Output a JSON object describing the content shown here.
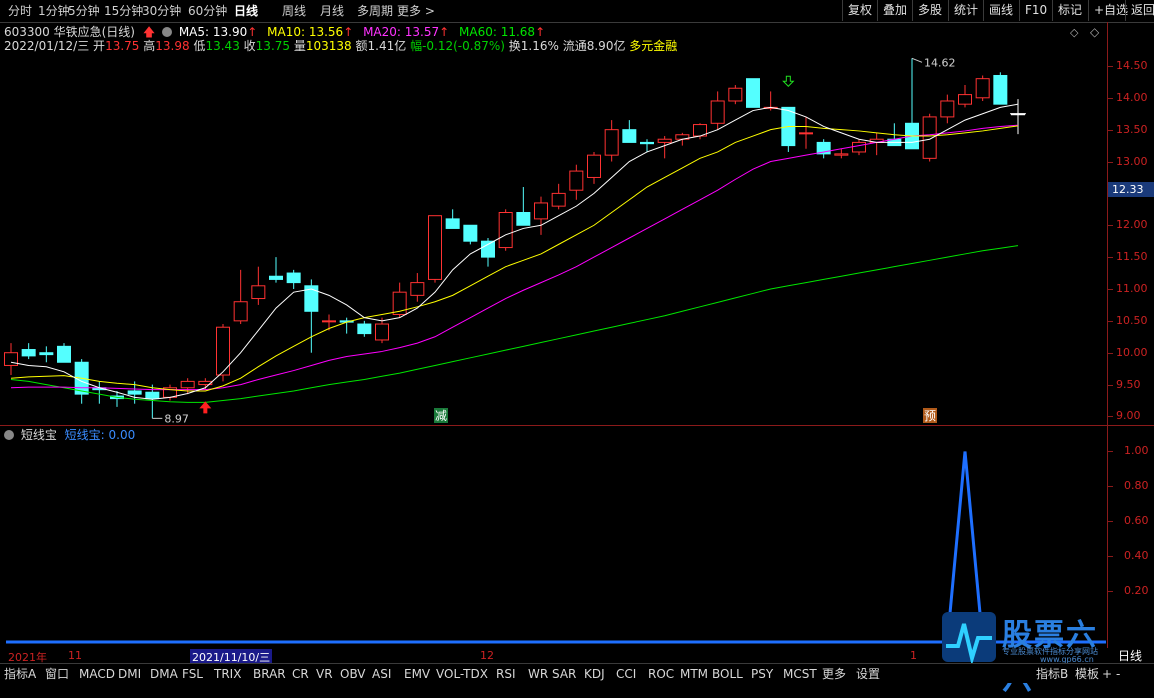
{
  "toolbar": {
    "periods": [
      "分时",
      "1分钟",
      "5分钟",
      "15分钟",
      "30分钟",
      "60分钟",
      "日线",
      "周线",
      "月线",
      "多周期",
      "更多 >"
    ],
    "active_period": "日线",
    "right_buttons": [
      "复权",
      "叠加",
      "多股",
      "统计",
      "画线",
      "F10",
      "标记",
      "+自选",
      "返回"
    ]
  },
  "stock": {
    "header": "603300 华铁应急(日线)",
    "ma5": "MA5: 13.90",
    "ma10": "MA10: 13.56",
    "ma20": "MA20: 13.57",
    "ma60": "MA60: 11.68",
    "date": "2022/01/12/三",
    "open_label": "开",
    "open": "13.75",
    "high_label": "高",
    "high": "13.98",
    "low_label": "低",
    "low": "13.43",
    "close_label": "收",
    "close": "13.75",
    "vol_label": "量",
    "vol": "103138",
    "amt": "额1.41亿",
    "chg": "幅-0.12(-0.87%)",
    "turnover": "换1.16%",
    "float": "流通8.90亿",
    "concept": "多元金融"
  },
  "price_axis": [
    "14.50",
    "14.00",
    "13.50",
    "13.00",
    "12.50",
    "12.00",
    "11.50",
    "11.00",
    "10.50",
    "10.00",
    "9.50",
    "9.00"
  ],
  "current_price_tag": "12.33",
  "annotations": {
    "high_mark": "14.62",
    "low_mark": "8.97",
    "sig_jian": "减",
    "sig_yu": "预"
  },
  "indicator": {
    "name": "短线宝",
    "value_text": "短线宝: 0.00",
    "axis": [
      "1.00",
      "0.80",
      "0.60",
      "0.40",
      "0.20"
    ]
  },
  "date_axis": [
    "2021年",
    "11",
    "2021/11/10/三",
    "12",
    "1"
  ],
  "bottom_tabs": [
    "指标A",
    "窗口",
    "MACD",
    "DMI",
    "DMA",
    "FSL",
    "TRIX",
    "BRAR",
    "CR",
    "VR",
    "OBV",
    "ASI",
    "EMV",
    "VOL-TDX",
    "RSI",
    "WR",
    "SAR",
    "KDJ",
    "CCI",
    "ROC",
    "MTM",
    "BOLL",
    "PSY",
    "MCST",
    "更多",
    "设置"
  ],
  "bottom_right": [
    "指标B",
    "模板",
    "+",
    "-",
    "日线"
  ],
  "watermark": {
    "title": "股票六六",
    "sub": "专业股票软件指标分享网站",
    "url": "www.gp66.cn"
  },
  "colors": {
    "up": "#ff3232",
    "down": "#54ffff",
    "ma5": "#ffffff",
    "ma10": "#ffff00",
    "ma20": "#ff00ff",
    "ma60": "#00e600",
    "indicator": "#1e6fff"
  },
  "chart_data": {
    "type": "candlestick",
    "price_range": [
      8.85,
      14.75
    ],
    "candles": [
      {
        "o": 9.8,
        "h": 10.15,
        "l": 9.65,
        "c": 10.0
      },
      {
        "o": 10.05,
        "h": 10.15,
        "l": 9.9,
        "c": 9.95
      },
      {
        "o": 10.0,
        "h": 10.1,
        "l": 9.85,
        "c": 9.97
      },
      {
        "o": 10.1,
        "h": 10.15,
        "l": 9.85,
        "c": 9.85
      },
      {
        "o": 9.85,
        "h": 9.9,
        "l": 9.2,
        "c": 9.35
      },
      {
        "o": 9.45,
        "h": 9.55,
        "l": 9.2,
        "c": 9.42
      },
      {
        "o": 9.32,
        "h": 9.4,
        "l": 9.15,
        "c": 9.28
      },
      {
        "o": 9.4,
        "h": 9.55,
        "l": 9.2,
        "c": 9.35
      },
      {
        "o": 9.38,
        "h": 9.5,
        "l": 8.97,
        "c": 9.28
      },
      {
        "o": 9.3,
        "h": 9.5,
        "l": 9.25,
        "c": 9.45
      },
      {
        "o": 9.45,
        "h": 9.6,
        "l": 9.35,
        "c": 9.55
      },
      {
        "o": 9.5,
        "h": 9.6,
        "l": 9.42,
        "c": 9.55
      },
      {
        "o": 9.65,
        "h": 10.45,
        "l": 9.55,
        "c": 10.4
      },
      {
        "o": 10.5,
        "h": 11.3,
        "l": 10.45,
        "c": 10.8
      },
      {
        "o": 10.85,
        "h": 11.35,
        "l": 10.75,
        "c": 11.05
      },
      {
        "o": 11.2,
        "h": 11.5,
        "l": 11.1,
        "c": 11.15
      },
      {
        "o": 11.25,
        "h": 11.3,
        "l": 11.0,
        "c": 11.1
      },
      {
        "o": 11.05,
        "h": 11.15,
        "l": 10.0,
        "c": 10.65
      },
      {
        "o": 10.5,
        "h": 10.6,
        "l": 10.35,
        "c": 10.5
      },
      {
        "o": 10.5,
        "h": 10.55,
        "l": 10.3,
        "c": 10.48
      },
      {
        "o": 10.45,
        "h": 10.5,
        "l": 10.25,
        "c": 10.3
      },
      {
        "o": 10.2,
        "h": 10.55,
        "l": 10.15,
        "c": 10.45
      },
      {
        "o": 10.6,
        "h": 11.1,
        "l": 10.55,
        "c": 10.95
      },
      {
        "o": 10.9,
        "h": 11.25,
        "l": 10.8,
        "c": 11.1
      },
      {
        "o": 11.15,
        "h": 12.15,
        "l": 11.1,
        "c": 12.15
      },
      {
        "o": 12.1,
        "h": 12.25,
        "l": 11.95,
        "c": 11.95
      },
      {
        "o": 12.0,
        "h": 12.0,
        "l": 11.7,
        "c": 11.75
      },
      {
        "o": 11.75,
        "h": 11.8,
        "l": 11.35,
        "c": 11.5
      },
      {
        "o": 11.65,
        "h": 12.25,
        "l": 11.6,
        "c": 12.2
      },
      {
        "o": 12.2,
        "h": 12.6,
        "l": 12.0,
        "c": 12.0
      },
      {
        "o": 12.1,
        "h": 12.45,
        "l": 11.85,
        "c": 12.35
      },
      {
        "o": 12.3,
        "h": 12.65,
        "l": 12.25,
        "c": 12.5
      },
      {
        "o": 12.55,
        "h": 12.95,
        "l": 12.4,
        "c": 12.85
      },
      {
        "o": 12.75,
        "h": 13.15,
        "l": 12.65,
        "c": 13.1
      },
      {
        "o": 13.1,
        "h": 13.65,
        "l": 13.0,
        "c": 13.5
      },
      {
        "o": 13.5,
        "h": 13.65,
        "l": 13.3,
        "c": 13.3
      },
      {
        "o": 13.3,
        "h": 13.35,
        "l": 13.15,
        "c": 13.28
      },
      {
        "o": 13.3,
        "h": 13.4,
        "l": 13.05,
        "c": 13.35
      },
      {
        "o": 13.35,
        "h": 13.45,
        "l": 13.25,
        "c": 13.42
      },
      {
        "o": 13.4,
        "h": 13.6,
        "l": 13.35,
        "c": 13.58
      },
      {
        "o": 13.6,
        "h": 14.1,
        "l": 13.5,
        "c": 13.95
      },
      {
        "o": 13.95,
        "h": 14.2,
        "l": 13.9,
        "c": 14.15
      },
      {
        "o": 14.3,
        "h": 14.3,
        "l": 13.85,
        "c": 13.85
      },
      {
        "o": 13.85,
        "h": 14.1,
        "l": 13.8,
        "c": 13.85
      },
      {
        "o": 13.85,
        "h": 13.85,
        "l": 13.15,
        "c": 13.25
      },
      {
        "o": 13.45,
        "h": 13.7,
        "l": 13.2,
        "c": 13.45
      },
      {
        "o": 13.3,
        "h": 13.35,
        "l": 13.05,
        "c": 13.12
      },
      {
        "o": 13.1,
        "h": 13.2,
        "l": 13.05,
        "c": 13.12
      },
      {
        "o": 13.15,
        "h": 13.35,
        "l": 13.1,
        "c": 13.3
      },
      {
        "o": 13.3,
        "h": 13.45,
        "l": 13.1,
        "c": 13.35
      },
      {
        "o": 13.35,
        "h": 13.6,
        "l": 13.25,
        "c": 13.25
      },
      {
        "o": 13.6,
        "h": 14.62,
        "l": 13.2,
        "c": 13.2
      },
      {
        "o": 13.05,
        "h": 13.75,
        "l": 13.0,
        "c": 13.7
      },
      {
        "o": 13.7,
        "h": 14.05,
        "l": 13.6,
        "c": 13.95
      },
      {
        "o": 13.9,
        "h": 14.2,
        "l": 13.85,
        "c": 14.05
      },
      {
        "o": 14.0,
        "h": 14.35,
        "l": 13.95,
        "c": 14.3
      },
      {
        "o": 14.35,
        "h": 14.4,
        "l": 13.9,
        "c": 13.9
      },
      {
        "o": 13.75,
        "h": 13.98,
        "l": 13.43,
        "c": 13.75
      }
    ],
    "ma5": [
      9.85,
      9.8,
      9.78,
      9.7,
      9.55,
      9.45,
      9.38,
      9.3,
      9.27,
      9.3,
      9.36,
      9.45,
      9.7,
      10.0,
      10.35,
      10.7,
      10.95,
      11.0,
      10.9,
      10.75,
      10.55,
      10.5,
      10.55,
      10.7,
      10.95,
      11.3,
      11.55,
      11.7,
      11.85,
      11.95,
      12.0,
      12.15,
      12.3,
      12.5,
      12.75,
      13.0,
      13.15,
      13.25,
      13.35,
      13.4,
      13.5,
      13.65,
      13.8,
      13.85,
      13.8,
      13.7,
      13.55,
      13.45,
      13.35,
      13.3,
      13.3,
      13.3,
      13.35,
      13.5,
      13.65,
      13.75,
      13.85,
      13.9
    ],
    "ma10": [
      9.6,
      9.62,
      9.63,
      9.64,
      9.6,
      9.55,
      9.52,
      9.5,
      9.45,
      9.42,
      9.4,
      9.4,
      9.48,
      9.6,
      9.78,
      9.95,
      10.1,
      10.25,
      10.38,
      10.48,
      10.55,
      10.6,
      10.65,
      10.72,
      10.8,
      10.9,
      11.05,
      11.2,
      11.35,
      11.45,
      11.55,
      11.7,
      11.85,
      12.0,
      12.2,
      12.4,
      12.6,
      12.75,
      12.9,
      13.05,
      13.15,
      13.3,
      13.4,
      13.5,
      13.55,
      13.55,
      13.52,
      13.5,
      13.48,
      13.45,
      13.42,
      13.4,
      13.4,
      13.42,
      13.45,
      13.48,
      13.52,
      13.56
    ],
    "ma20": [
      9.45,
      9.46,
      9.46,
      9.46,
      9.45,
      9.45,
      9.44,
      9.43,
      9.42,
      9.42,
      9.42,
      9.42,
      9.45,
      9.5,
      9.58,
      9.65,
      9.72,
      9.8,
      9.88,
      9.94,
      9.98,
      10.02,
      10.08,
      10.15,
      10.25,
      10.4,
      10.55,
      10.7,
      10.85,
      10.98,
      11.1,
      11.22,
      11.35,
      11.5,
      11.65,
      11.8,
      11.95,
      12.1,
      12.25,
      12.4,
      12.55,
      12.72,
      12.88,
      13.0,
      13.05,
      13.1,
      13.15,
      13.2,
      13.25,
      13.3,
      13.35,
      13.4,
      13.42,
      13.45,
      13.48,
      13.52,
      13.55,
      13.57
    ],
    "ma60": [
      9.58,
      9.55,
      9.5,
      9.45,
      9.4,
      9.35,
      9.3,
      9.27,
      9.25,
      9.23,
      9.22,
      9.22,
      9.25,
      9.28,
      9.32,
      9.36,
      9.4,
      9.45,
      9.5,
      9.54,
      9.58,
      9.63,
      9.68,
      9.74,
      9.8,
      9.86,
      9.92,
      9.98,
      10.04,
      10.1,
      10.16,
      10.22,
      10.28,
      10.34,
      10.4,
      10.46,
      10.52,
      10.58,
      10.65,
      10.72,
      10.79,
      10.86,
      10.93,
      11.0,
      11.05,
      11.1,
      11.15,
      11.2,
      11.25,
      11.3,
      11.35,
      11.4,
      11.45,
      11.5,
      11.55,
      11.6,
      11.64,
      11.68
    ],
    "indicator": {
      "type": "line",
      "y_range": [
        0,
        1.05
      ],
      "values_rule": "0 everywhere except a single spike of 1.00 at the 4th-last bar",
      "spike_index": 54
    }
  }
}
